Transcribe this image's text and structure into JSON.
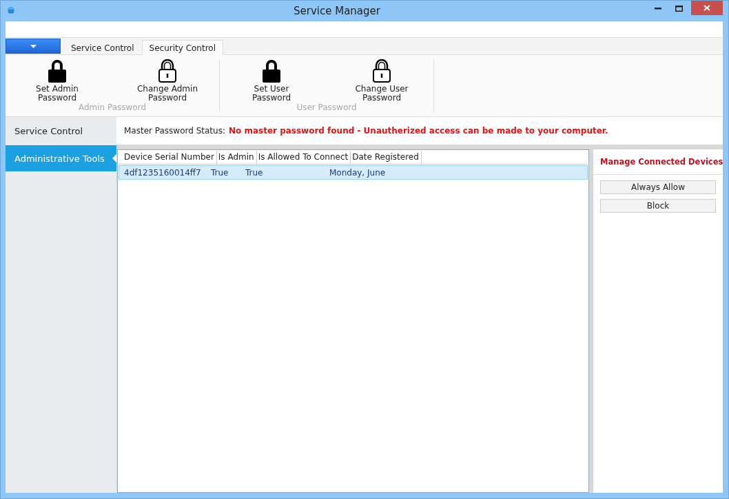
{
  "window": {
    "title": "Service Manager"
  },
  "tabs": [
    {
      "label": "Service Control",
      "selected": false
    },
    {
      "label": "Security Control",
      "selected": true
    }
  ],
  "ribbon_groups": [
    {
      "label": "Admin Password",
      "buttons": [
        {
          "kind": "set",
          "label": "Set Admin Password"
        },
        {
          "kind": "change",
          "label": "Change Admin Password"
        }
      ]
    },
    {
      "label": "User Password",
      "buttons": [
        {
          "kind": "set",
          "label": "Set User Password"
        },
        {
          "kind": "change",
          "label": "Change User Password"
        }
      ]
    }
  ],
  "sidebar": {
    "items": [
      {
        "label": "Service Control",
        "selected": false
      },
      {
        "label": "Administrative Tools",
        "selected": true
      }
    ]
  },
  "status": {
    "label": "Master Password Status:",
    "message": "No master password found - Unautherized access can be made to your computer."
  },
  "table": {
    "columns": [
      "Device Serial Number",
      "Is Admin",
      "Is Allowed To Connect",
      "Date Registered"
    ],
    "rows": [
      {
        "cells": [
          "4df1235160014ff7",
          "True",
          "True",
          "Monday, June"
        ],
        "selected": true
      }
    ]
  },
  "side_panel": {
    "title": "Manage Connected Devices",
    "buttons": [
      "Always Allow",
      "Block"
    ]
  }
}
